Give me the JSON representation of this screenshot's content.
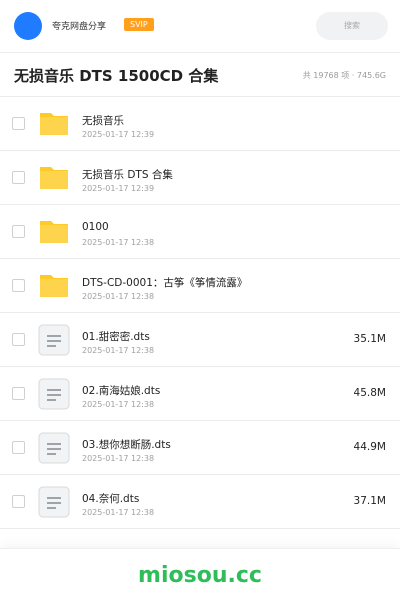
{
  "header": {
    "user_name": "夸克网盘分享",
    "badge": "SVIP",
    "search_placeholder": "搜索"
  },
  "title_bar": {
    "title": "无损音乐 DTS 1500CD 合集",
    "summary": "共 19768 项 · 745.6G"
  },
  "colors": {
    "accent": "#1f7bff",
    "badge": "#ff9f1c",
    "folder": "#ffc926",
    "brand": "#2ebd59"
  },
  "files": [
    {
      "type": "folder",
      "icon": "folder-icon",
      "name": "无损音乐",
      "date": "2025-01-17 12:39",
      "size": ""
    },
    {
      "type": "folder",
      "icon": "folder-icon",
      "name": "无损音乐 DTS 合集",
      "date": "2025-01-17 12:39",
      "size": ""
    },
    {
      "type": "folder",
      "icon": "folder-icon",
      "name": "0100",
      "date": "2025-01-17 12:38",
      "size": ""
    },
    {
      "type": "folder",
      "icon": "folder-icon",
      "name": "DTS-CD-0001：古筝《筝情流露》",
      "date": "2025-01-17 12:38",
      "size": ""
    },
    {
      "type": "file",
      "icon": "document-icon",
      "name": "01.甜密密.dts",
      "date": "2025-01-17 12:38",
      "size": "35.1M"
    },
    {
      "type": "file",
      "icon": "document-icon",
      "name": "02.南海姑娘.dts",
      "date": "2025-01-17 12:38",
      "size": "45.8M"
    },
    {
      "type": "file",
      "icon": "document-icon",
      "name": "03.想你想断肠.dts",
      "date": "2025-01-17 12:38",
      "size": "44.9M"
    },
    {
      "type": "file",
      "icon": "document-icon",
      "name": "04.奈何.dts",
      "date": "2025-01-17 12:38",
      "size": "37.1M"
    }
  ],
  "footer": {
    "brand": "miosou.cc"
  }
}
